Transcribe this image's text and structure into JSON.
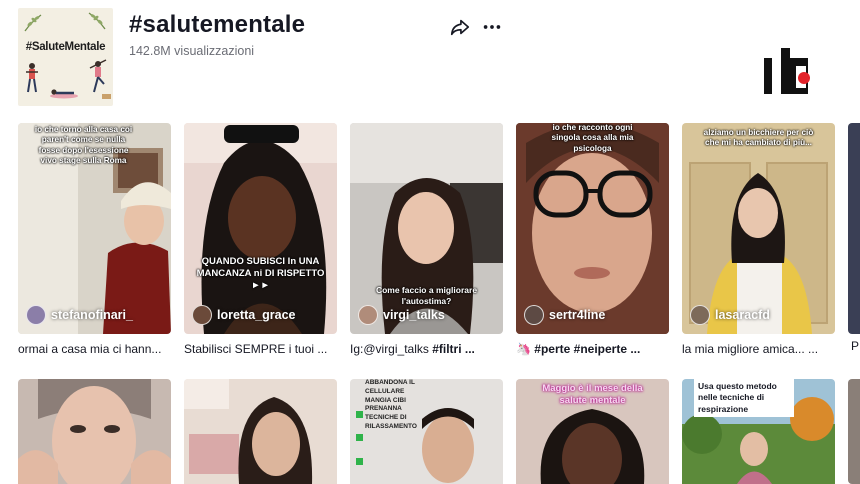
{
  "header": {
    "cover_title": "#SaluteMentale",
    "title": "#salutementale",
    "views": "142.8M visualizzazioni",
    "share_icon": "share-arrow-icon",
    "more_icon": "more-dots-icon"
  },
  "videos": [
    {
      "overlay": "io che torno alla casa coi paren't come se nulla fosse dopo l'esessione vivo stage sulla Roma",
      "author": "stefanofinari_",
      "caption": "ormai a casa mia ci hann..."
    },
    {
      "overlay": "QUANDO SUBISCI In UNA MANCANZA ni DI RISPETTO ►►",
      "author": "loretta_grace",
      "caption": "Stabilisci SEMPRE i tuoi ..."
    },
    {
      "overlay": "Come faccio a migliorare l'autostima?",
      "author": "virgi_talks",
      "caption_plain": "Ig:@virgi_talks ",
      "caption_bold": "#filtri ..."
    },
    {
      "overlay": "io che racconto ogni singola cosa alla mia psicologa",
      "author": "sertr4line",
      "caption_icon": "🦄",
      "caption_bold": "#perte #neiperte ..."
    },
    {
      "overlay": "alziamo un bicchiere per ciò che mi ha cambiato di più...",
      "author": "lasaracfd",
      "caption": "la mia migliore amica... ..."
    },
    {
      "overlay": "",
      "author": "",
      "caption": ""
    },
    {
      "overlay": "",
      "author": "",
      "caption": ""
    },
    {
      "overlay": "ABBANDONA IL CELLULARE\nMANGIA CIBI PRENANNA\nTECNICHE DI RILASSAMENTO",
      "author": "",
      "caption": ""
    },
    {
      "overlay": "Maggio è il mese della salute mentale",
      "author": "",
      "caption": ""
    },
    {
      "overlay": "Usa questo metodo nelle tecniche di respirazione",
      "author": "",
      "caption": ""
    }
  ],
  "peek_caption": "P"
}
